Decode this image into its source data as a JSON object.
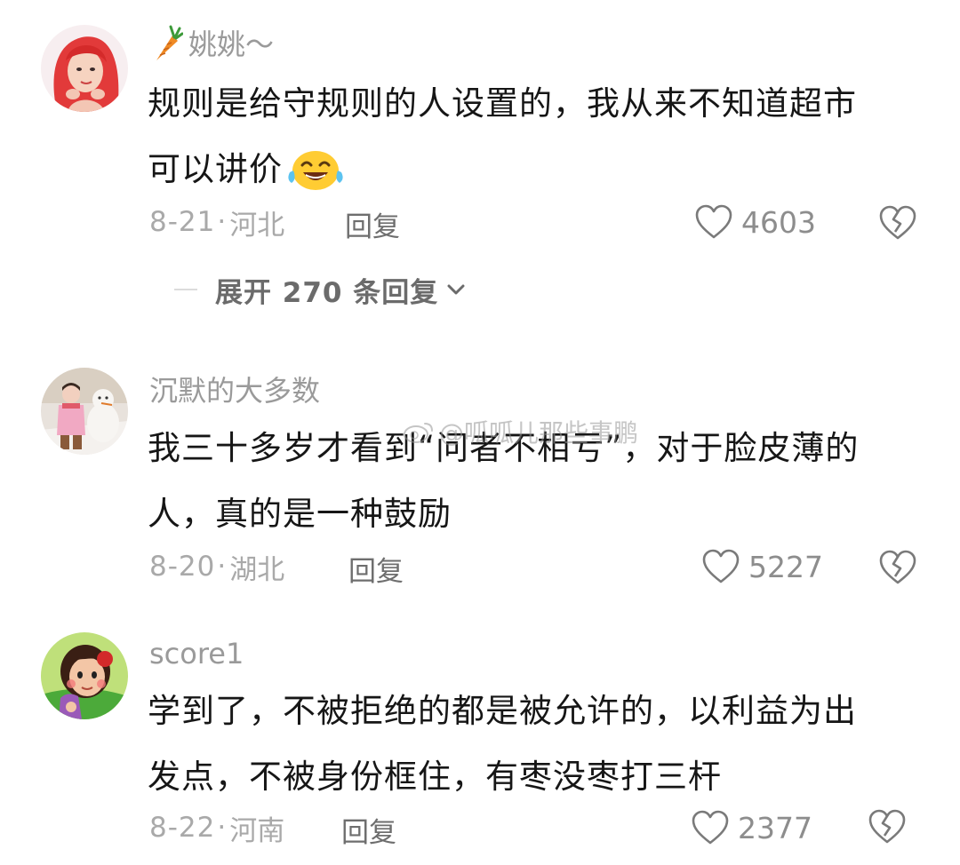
{
  "comments": [
    {
      "username": "姚姚～",
      "badge_icon": "carrot-icon",
      "text_line1": "规则是给守规则的人设置的，我从来不知道超市",
      "text_line2": "可以讲价",
      "emoji": "laughing-tears-emoji",
      "date": "8-21",
      "separator": "·",
      "location": "河北",
      "reply_label": "回复",
      "likes": "4603",
      "expand_label": "展开 270 条回复"
    },
    {
      "username": "沉默的大多数",
      "text_line1": "我三十多岁才看到“问者不相亏”，对于脸皮薄的",
      "text_line2": "人，真的是一种鼓励",
      "date": "8-20",
      "separator": "·",
      "location": "湖北",
      "reply_label": "回复",
      "likes": "5227"
    },
    {
      "username": "score1",
      "text_line1": "学到了，不被拒绝的都是被允许的，以利益为出",
      "text_line2": "发点，不被身份框住，有枣没枣打三杆",
      "date": "8-22",
      "separator": "·",
      "location": "河南",
      "reply_label": "回复",
      "likes": "2377"
    }
  ],
  "watermark": "@呱呱儿那些事鹏",
  "colors": {
    "text": "#161616",
    "meta": "#a9a9a9",
    "username": "#9a9a9a",
    "icon_stroke": "#7a7a7a"
  }
}
